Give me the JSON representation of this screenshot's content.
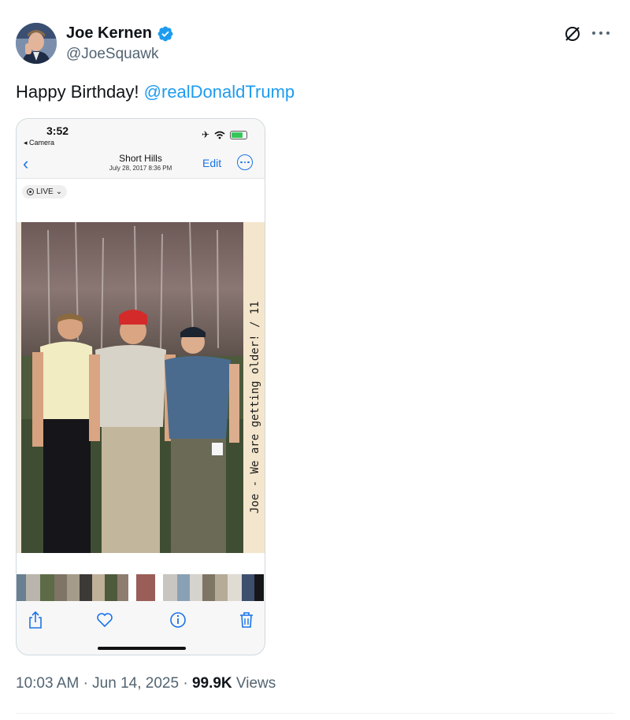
{
  "author": {
    "name": "Joe Kernen",
    "handle": "@JoeSquawk",
    "verified_color": "#1d9bf0"
  },
  "header_icons": [
    "grok-icon",
    "more-icon"
  ],
  "tweet": {
    "text": "Happy Birthday!",
    "mention": "@realDonaldTrump"
  },
  "media": {
    "phone": {
      "time": "3:52",
      "back_app": "◂ Camera"
    },
    "photos_nav": {
      "title": "Short Hills",
      "subtitle": "July 28, 2017  8:36 PM",
      "edit_label": "Edit"
    },
    "live_label": "LIVE",
    "handwriting": "Joe - We are getting older! / 11",
    "toolbar_icons": [
      "share-icon",
      "heart-icon",
      "info-icon",
      "trash-icon"
    ]
  },
  "footer": {
    "time": "10:03 AM",
    "date": "Jun 14, 2025",
    "views_count": "99.9K",
    "views_label": "Views"
  },
  "colors": {
    "link": "#1d9bf0",
    "text": "#0f1419",
    "secondary": "#536471",
    "ios_blue": "#1a73e8"
  }
}
